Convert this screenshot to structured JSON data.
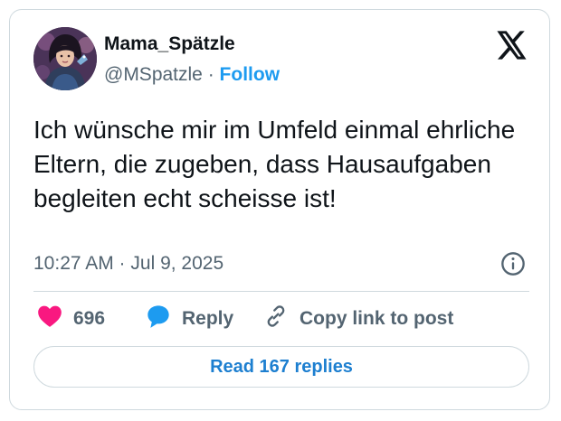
{
  "author": {
    "display_name": "Mama_Spätzle",
    "handle": "@MSpatzle",
    "separator": "·",
    "follow_label": "Follow"
  },
  "tweet": {
    "text": "Ich wünsche mir im Umfeld einmal ehrliche Eltern, die zugeben, dass Hausaufgaben begleiten echt scheisse ist!",
    "timestamp": "10:27 AM · Jul 9, 2025"
  },
  "actions": {
    "like_count": "696",
    "reply_label": "Reply",
    "copy_link_label": "Copy link to post"
  },
  "replies_button_label": "Read 167 replies",
  "icons": {
    "brand": "x-logo-icon",
    "info": "info-icon",
    "like": "heart-icon",
    "reply": "speech-bubble-icon",
    "copy": "link-icon"
  },
  "colors": {
    "accent": "#1d9bf0",
    "like": "#f91880",
    "text_primary": "#0f1419",
    "text_secondary": "#536471",
    "border": "#cfd9de"
  }
}
